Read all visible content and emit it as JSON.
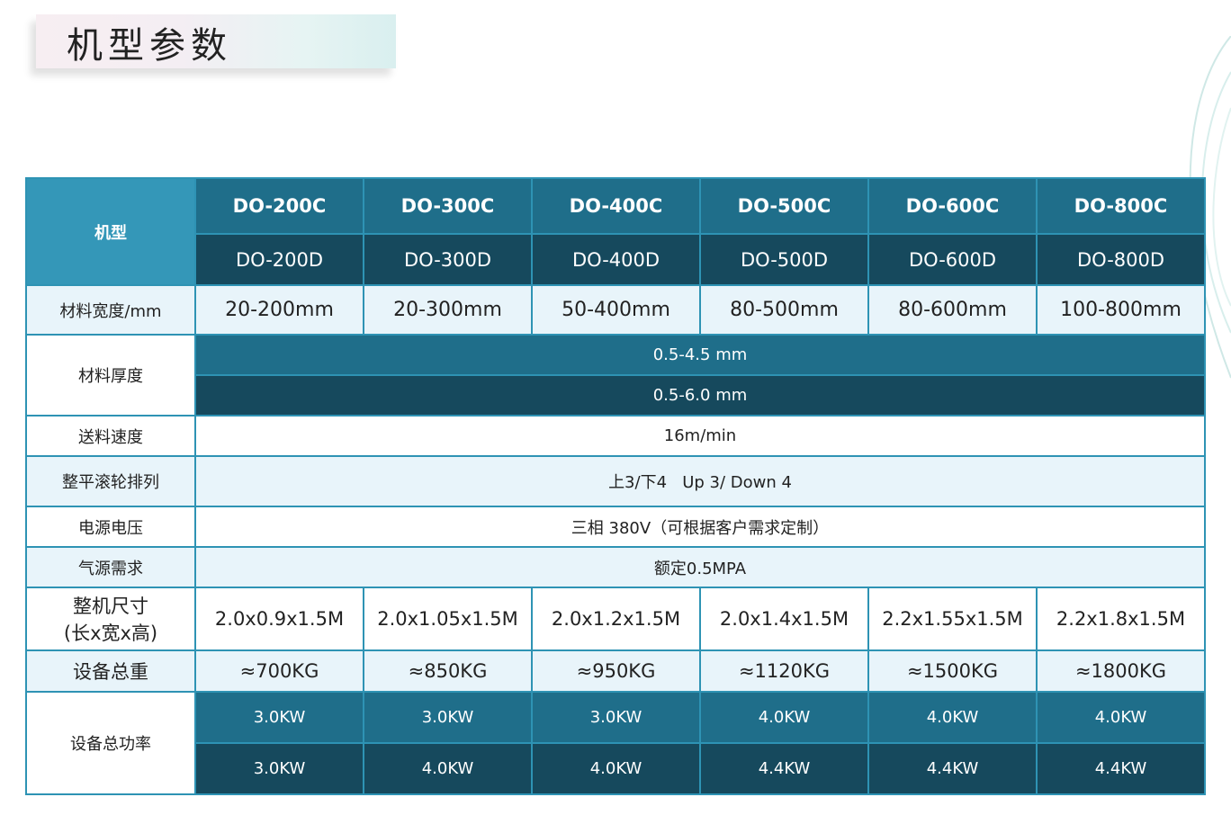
{
  "page_title": "机型参数",
  "header": {
    "label": "机型",
    "models_c": [
      "DO-200C",
      "DO-300C",
      "DO-400C",
      "DO-500C",
      "DO-600C",
      "DO-800C"
    ],
    "models_d": [
      "DO-200D",
      "DO-300D",
      "DO-400D",
      "DO-500D",
      "DO-600D",
      "DO-800D"
    ]
  },
  "width_row": {
    "label": "材料宽度/mm",
    "values": [
      "20-200mm",
      "20-300mm",
      "50-400mm",
      "80-500mm",
      "80-600mm",
      "100-800mm"
    ]
  },
  "thickness_row": {
    "label": "材料厚度",
    "value_c": "0.5-4.5 mm",
    "value_d": "0.5-6.0 mm"
  },
  "speed_row": {
    "label": "送料速度",
    "value": "16m/min"
  },
  "roller_row": {
    "label": "整平滚轮排列",
    "value": "上3/下4   Up 3/ Down 4"
  },
  "voltage_row": {
    "label": "电源电压",
    "value": "三相 380V（可根据客户需求定制）"
  },
  "air_row": {
    "label": "气源需求",
    "value": "额定0.5MPA"
  },
  "size_row": {
    "label_1": "整机尺寸",
    "label_2": "(长x宽x高)",
    "values": [
      "2.0x0.9x1.5M",
      "2.0x1.05x1.5M",
      "2.0x1.2x1.5M",
      "2.0x1.4x1.5M",
      "2.2x1.55x1.5M",
      "2.2x1.8x1.5M"
    ]
  },
  "weight_row": {
    "label": "设备总重",
    "values": [
      "≈700KG",
      "≈850KG",
      "≈950KG",
      "≈1120KG",
      "≈1500KG",
      "≈1800KG"
    ]
  },
  "power_row": {
    "label": "设备总功率",
    "values_c": [
      "3.0KW",
      "3.0KW",
      "3.0KW",
      "4.0KW",
      "4.0KW",
      "4.0KW"
    ],
    "values_d": [
      "3.0KW",
      "4.0KW",
      "4.0KW",
      "4.4KW",
      "4.4KW",
      "4.4KW"
    ]
  },
  "colors": {
    "header_light": "#3497b8",
    "header_mid": "#1f6e8a",
    "header_dark": "#16495d",
    "row_light": "#e8f4fa"
  }
}
